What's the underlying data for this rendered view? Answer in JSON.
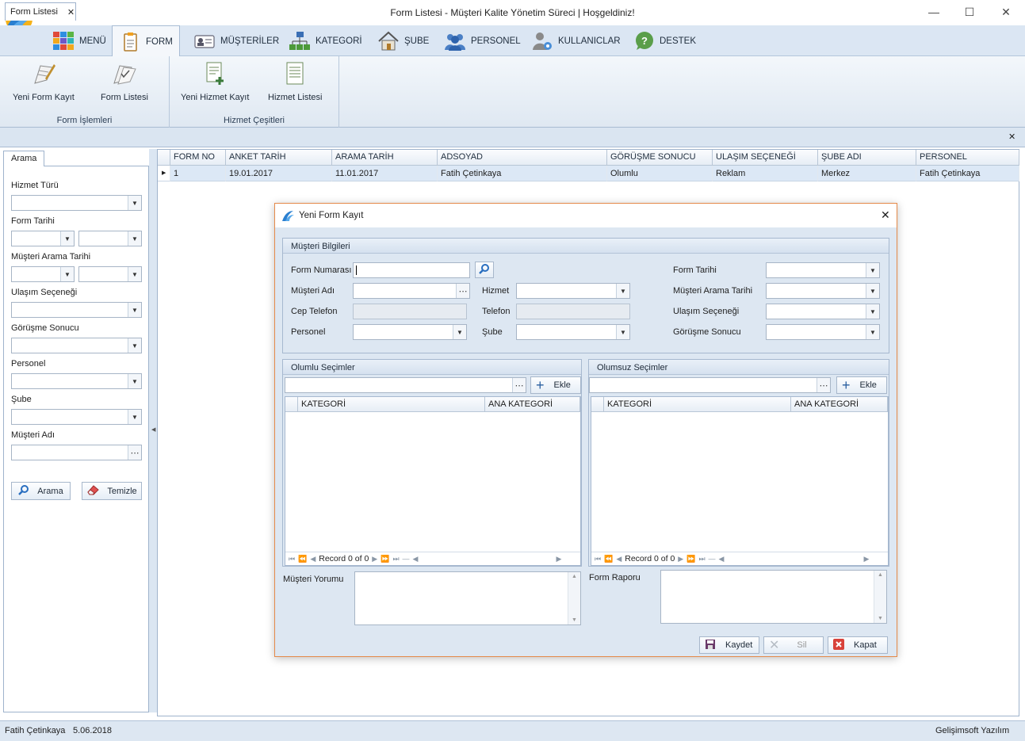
{
  "window": {
    "title": "Form Listesi - Müşteri Kalite Yönetim Süreci | Hoşgeldiniz!"
  },
  "ribbon": {
    "tabs": [
      {
        "label": "MENÜ",
        "icon": "tiles-icon"
      },
      {
        "label": "FORM",
        "icon": "clipboard-icon"
      },
      {
        "label": "MÜŞTERİLER",
        "icon": "id-card-icon"
      },
      {
        "label": "KATEGORİ",
        "icon": "hierarchy-icon"
      },
      {
        "label": "ŞUBE",
        "icon": "house-icon"
      },
      {
        "label": "PERSONEL",
        "icon": "people-icon"
      },
      {
        "label": "KULLANICLAR",
        "icon": "user-gear-icon"
      },
      {
        "label": "DESTEK",
        "icon": "help-bubble-icon"
      }
    ],
    "groups": [
      {
        "label": "Form İşlemleri",
        "buttons": [
          "Yeni Form Kayıt",
          "Form Listesi"
        ]
      },
      {
        "label": "Hizmet Çeşitleri",
        "buttons": [
          "Yeni Hizmet Kayıt",
          "Hizmet Listesi"
        ]
      }
    ]
  },
  "doc_tab": {
    "label": "Form Listesi"
  },
  "filter": {
    "tab": "Arama",
    "labels": {
      "hizmet_turu": "Hizmet Türü",
      "form_tarihi": "Form Tarihi",
      "musteri_arama_tarihi": "Müşteri Arama Tarihi",
      "ulasim_secenegi": "Ulaşım Seçeneği",
      "gorusme_sonucu": "Görüşme Sonucu",
      "personel": "Personel",
      "sube": "Şube",
      "musteri_adi": "Müşteri Adı"
    },
    "search_button": "Arama",
    "clear_button": "Temizle"
  },
  "grid": {
    "columns": [
      "FORM NO",
      "ANKET TARİH",
      "ARAMA TARİH",
      "ADSOYAD",
      "GÖRÜŞME SONUCU",
      "ULAŞIM SEÇENEĞİ",
      "ŞUBE ADI",
      "PERSONEL"
    ],
    "rows": [
      [
        "1",
        "19.01.2017",
        "11.01.2017",
        "Fatih Çetinkaya",
        "Olumlu",
        "Reklam",
        "Merkez",
        "Fatih Çetinkaya"
      ]
    ]
  },
  "status": {
    "user": "Fatih Çetinkaya",
    "date": "5.06.2018",
    "company": "Gelişimsoft Yazılım"
  },
  "dialog": {
    "title": "Yeni Form Kayıt",
    "customer_group": "Müşteri Bilgileri",
    "labels": {
      "form_numarasi": "Form Numarası",
      "musteri_adi": "Müşteri Adı",
      "cep_telefon": "Cep Telefon",
      "personel": "Personel",
      "hizmet": "Hizmet",
      "telefon": "Telefon",
      "sube": "Şube",
      "form_tarihi": "Form Tarihi",
      "musteri_arama_tarihi": "Müşteri Arama Tarihi",
      "ulasim_secenegi": "Ulaşım Seçeneği",
      "gorusme_sonucu": "Görüşme Sonucu"
    },
    "positive_group": "Olumlu Seçimler",
    "negative_group": "Olumsuz Seçimler",
    "add_button": "Ekle",
    "category_columns": [
      "KATEGORİ",
      "ANA KATEGORİ"
    ],
    "record_text": "Record 0 of 0",
    "customer_comment": "Müşteri Yorumu",
    "form_report": "Form Raporu",
    "buttons": {
      "save": "Kaydet",
      "delete": "Sil",
      "close": "Kapat"
    }
  }
}
